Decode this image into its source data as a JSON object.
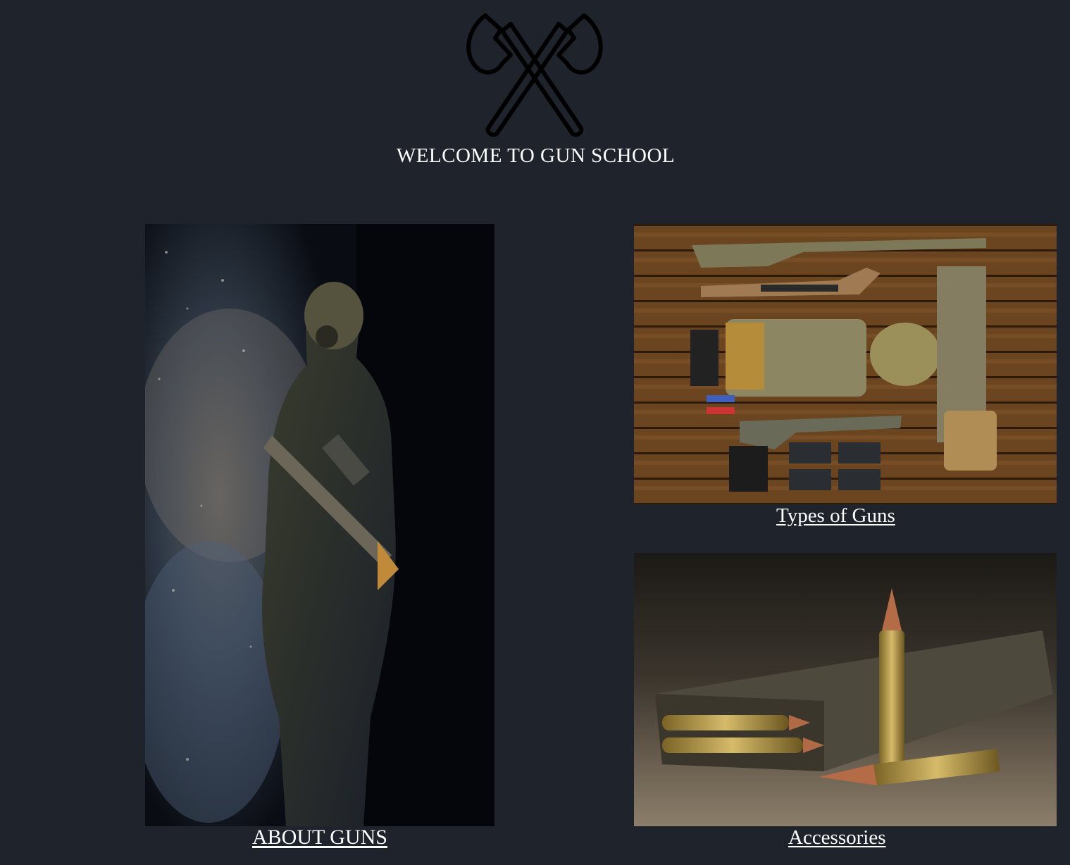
{
  "header": {
    "logo_icon": "crossed-axes-icon",
    "title": "WELCOME TO GUN SCHOOL"
  },
  "cards": [
    {
      "id": "about",
      "link_text": "ABOUT GUNS",
      "image": "soldier-dust-photo"
    },
    {
      "id": "types",
      "link_text": "Types of Guns",
      "image": "gear-flatlay-photo"
    },
    {
      "id": "accessories",
      "link_text": "Accessories",
      "image": "magazine-ammo-photo"
    }
  ],
  "colors": {
    "background": "#1f232b",
    "text": "#ffffff",
    "logo_stroke": "#000000"
  }
}
